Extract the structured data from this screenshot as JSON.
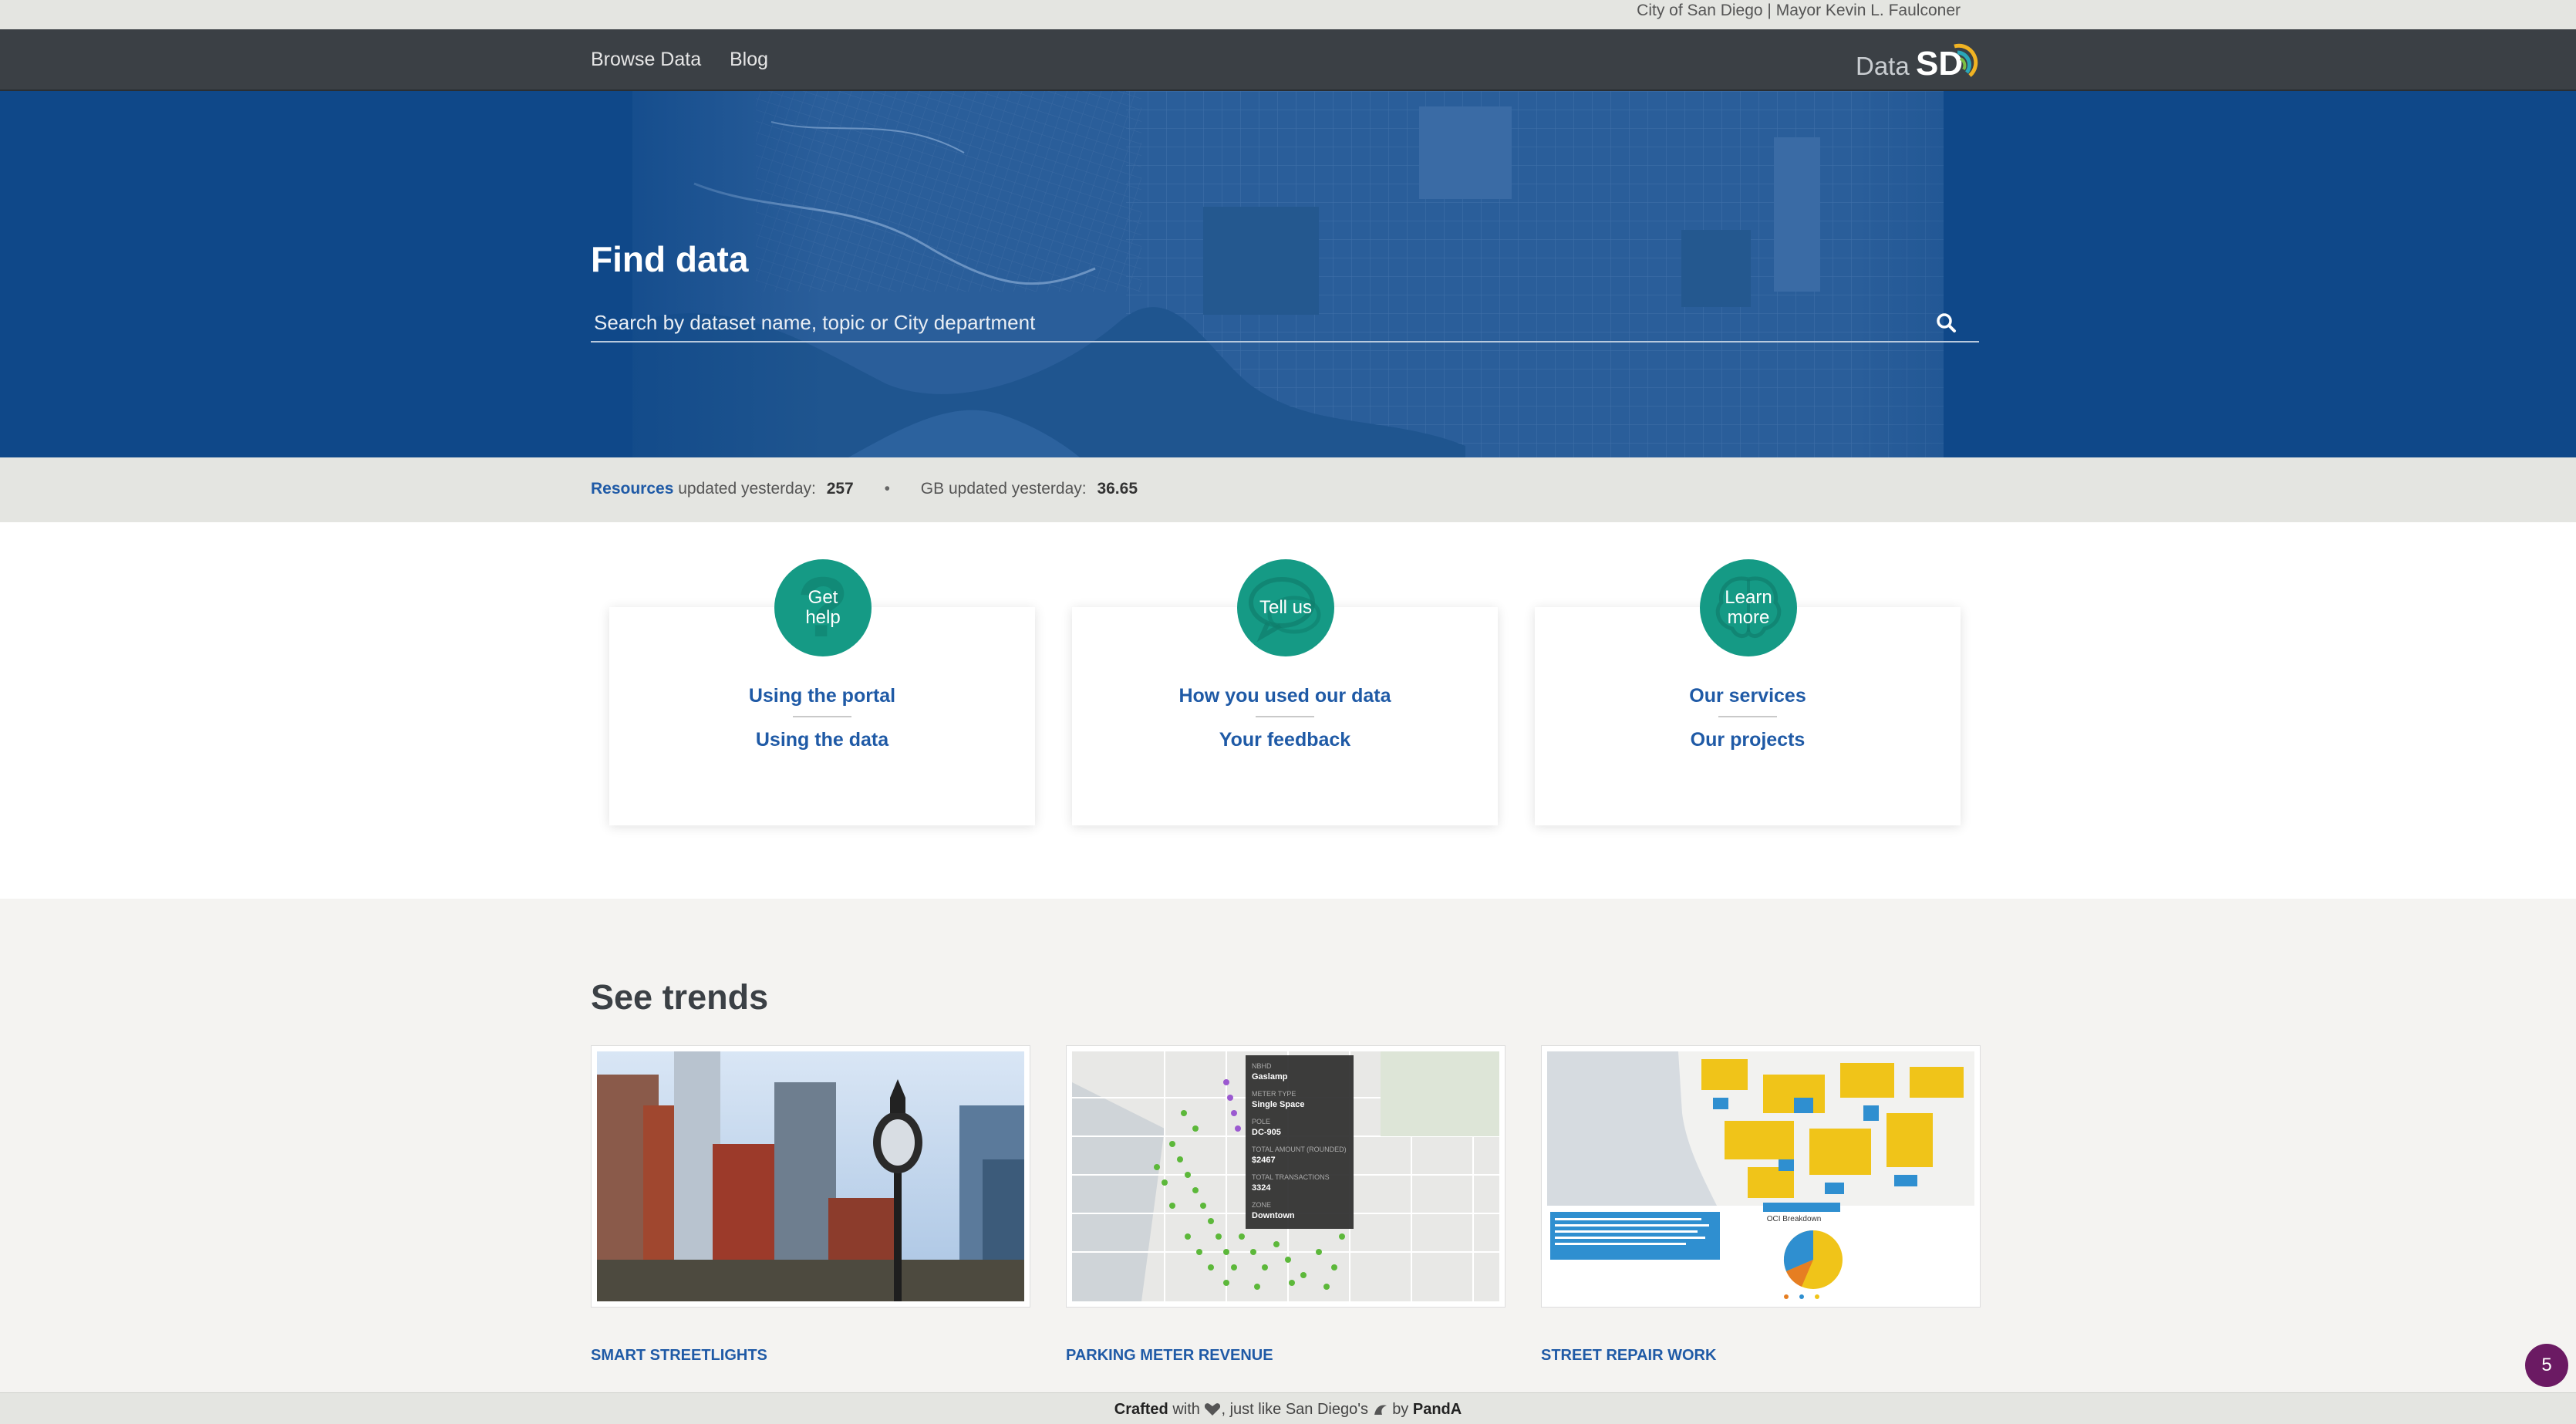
{
  "topbar": {
    "text": "City of San Diego | Mayor Kevin L. Faulconer"
  },
  "nav": {
    "browse_label": "Browse Data",
    "blog_label": "Blog",
    "logo_data": "Data",
    "logo_sd": "SD"
  },
  "hero": {
    "title": "Find data",
    "search_placeholder": "Search by dataset name, topic or City department",
    "search_icon": "search-icon"
  },
  "stats": {
    "resources_link": "Resources",
    "resources_text": "updated yesterday:",
    "resources_value": "257",
    "separator": "•",
    "gb_text": "GB updated yesterday:",
    "gb_value": "36.65"
  },
  "cards": [
    {
      "badge": "Get help",
      "icon": "question-icon",
      "link1": "Using the portal",
      "link2": "Using the data"
    },
    {
      "badge": "Tell us",
      "icon": "speech-bubbles-icon",
      "link1": "How you used our data",
      "link2": "Your feedback"
    },
    {
      "badge": "Learn more",
      "icon": "brain-icon",
      "link1": "Our services",
      "link2": "Our projects"
    }
  ],
  "trends": {
    "title": "See trends",
    "items": [
      {
        "label": "SMART STREETLIGHTS"
      },
      {
        "label": "PARKING METER REVENUE",
        "tooltip": {
          "nbhd_label": "NBHD",
          "nbhd": "Gaslamp",
          "meter_type_label": "METER TYPE",
          "meter_type": "Single Space",
          "pole_label": "POLE",
          "pole": "DC-905",
          "amount_label": "TOTAL AMOUNT (ROUNDED)",
          "amount": "$2467",
          "transactions_label": "TOTAL TRANSACTIONS",
          "transactions": "3324",
          "zone_label": "ZONE",
          "zone": "Downtown"
        }
      },
      {
        "label": "STREET REPAIR WORK",
        "chart_title": "OCI Breakdown"
      }
    ]
  },
  "footer": {
    "crafted": "Crafted",
    "with": "with",
    "middle": ", just like San Diego's",
    "by": "by",
    "panda": "PandA"
  },
  "chat": {
    "count": "5"
  },
  "colors": {
    "hero_blue": "#0f4889",
    "nav_dark": "#3b4045",
    "teal": "#159a85",
    "link_blue": "#1f5aa6"
  }
}
